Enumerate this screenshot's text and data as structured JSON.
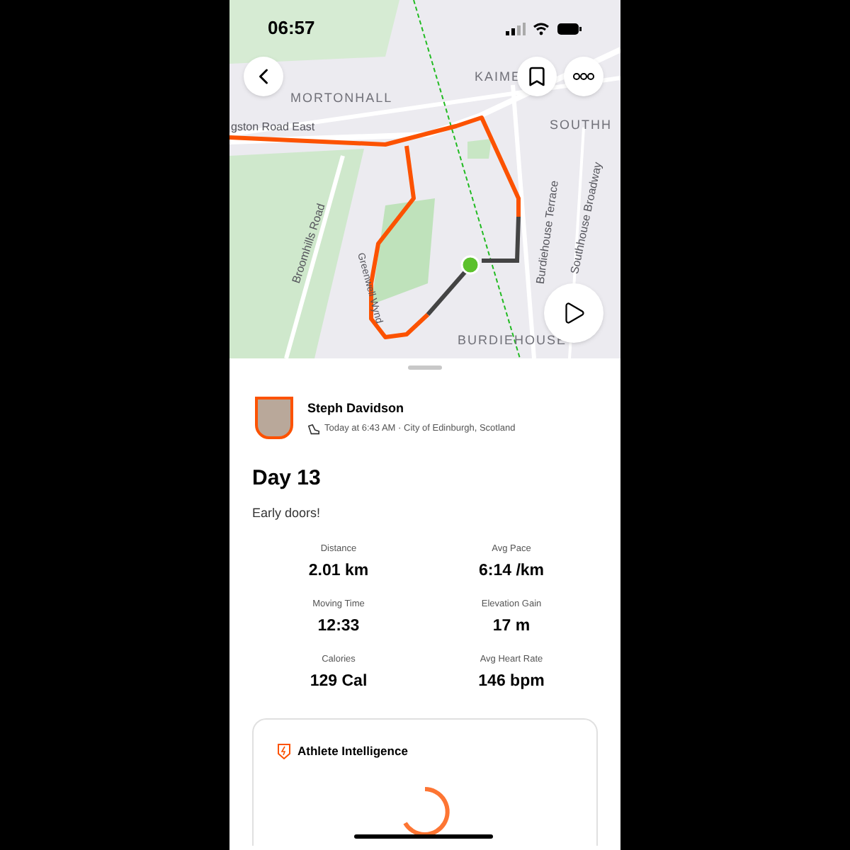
{
  "status_bar": {
    "time": "06:57"
  },
  "map": {
    "labels": [
      {
        "text": "MORTONHALL",
        "kind": "area"
      },
      {
        "text": "KAIME",
        "kind": "area"
      },
      {
        "text": "SOUTHH",
        "kind": "area"
      },
      {
        "text": "gston Road East",
        "kind": "road"
      },
      {
        "text": "Broomhills Road",
        "kind": "road"
      },
      {
        "text": "Greenwell Wynd",
        "kind": "road"
      },
      {
        "text": "Burdiehouse Terrace",
        "kind": "road"
      },
      {
        "text": "Southhouse Broadway",
        "kind": "road"
      },
      {
        "text": "BURDIEHOUSE",
        "kind": "area"
      }
    ]
  },
  "athlete": {
    "name": "Steph  Davidson",
    "meta": "Today at 6:43 AM · City of Edinburgh, Scotland"
  },
  "activity": {
    "title": "Day 13",
    "description": "Early doors!"
  },
  "stats": [
    {
      "label": "Distance",
      "value": "2.01 km"
    },
    {
      "label": "Avg Pace",
      "value": "6:14 /km"
    },
    {
      "label": "Moving Time",
      "value": "12:33"
    },
    {
      "label": "Elevation Gain",
      "value": "17 m"
    },
    {
      "label": "Calories",
      "value": "129 Cal"
    },
    {
      "label": "Avg Heart Rate",
      "value": "146 bpm"
    }
  ],
  "card": {
    "title": "Athlete Intelligence"
  }
}
